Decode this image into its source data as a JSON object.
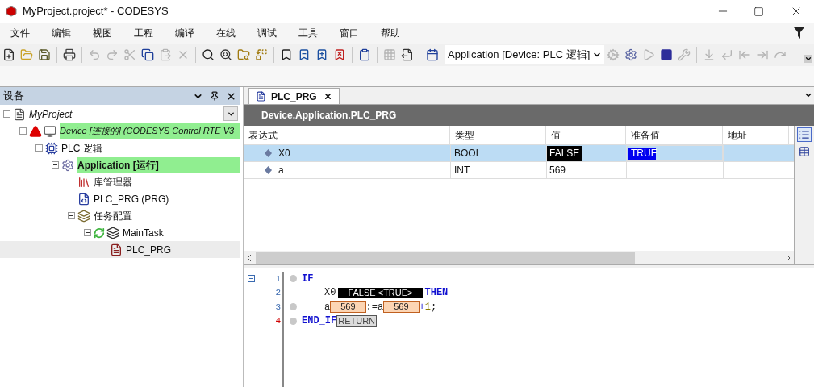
{
  "window": {
    "title": "MyProject.project* - CODESYS"
  },
  "menu": [
    "文件",
    "编辑",
    "视图",
    "工程",
    "编译",
    "在线",
    "调试",
    "工具",
    "窗口",
    "帮助"
  ],
  "toolbar": {
    "left": [
      {
        "kind": "new",
        "disabled": false
      },
      {
        "kind": "open",
        "disabled": false
      },
      {
        "kind": "save",
        "disabled": false
      },
      {
        "kind": "sep"
      },
      {
        "kind": "print",
        "disabled": false
      },
      {
        "kind": "sep"
      },
      {
        "kind": "undo",
        "disabled": true
      },
      {
        "kind": "redo",
        "disabled": true
      },
      {
        "kind": "cut",
        "disabled": true
      },
      {
        "kind": "copy",
        "disabled": false
      },
      {
        "kind": "paste",
        "disabled": true
      },
      {
        "kind": "delete",
        "disabled": true
      },
      {
        "kind": "sep"
      },
      {
        "kind": "find",
        "disabled": false
      },
      {
        "kind": "findnext",
        "disabled": false
      },
      {
        "kind": "findfolder",
        "disabled": false
      },
      {
        "kind": "replace",
        "disabled": false
      },
      {
        "kind": "sep"
      },
      {
        "kind": "bookmark",
        "disabled": false
      },
      {
        "kind": "bookmarkprev",
        "disabled": false
      },
      {
        "kind": "bookmarknext",
        "disabled": false
      },
      {
        "kind": "bookmarkclear",
        "disabled": false
      },
      {
        "kind": "sep"
      },
      {
        "kind": "objects",
        "disabled": false
      },
      {
        "kind": "sep"
      },
      {
        "kind": "grid",
        "disabled": true
      },
      {
        "kind": "export",
        "disabled": false
      },
      {
        "kind": "sep"
      },
      {
        "kind": "calendar",
        "disabled": false
      }
    ],
    "combo": {
      "value": "Application [Device: PLC 逻辑]"
    },
    "right": [
      {
        "kind": "login",
        "disabled": true
      },
      {
        "kind": "logout",
        "disabled": false
      },
      {
        "kind": "start",
        "disabled": true
      },
      {
        "kind": "stop",
        "disabled": false
      },
      {
        "kind": "reset",
        "disabled": true
      },
      {
        "kind": "sep"
      },
      {
        "kind": "stepover",
        "disabled": true
      },
      {
        "kind": "stepin",
        "disabled": true
      },
      {
        "kind": "stepout",
        "disabled": true
      },
      {
        "kind": "runto",
        "disabled": true
      },
      {
        "kind": "next",
        "disabled": true
      }
    ]
  },
  "devices_panel": {
    "title": "设备",
    "tree": [
      {
        "label": "MyProject",
        "kind": "project",
        "highlighted": false,
        "selected": false,
        "expanded": true,
        "children": [
          {
            "label": "Device [连接的] (CODESYS Control RTE V3",
            "kind": "device",
            "highlighted": true,
            "selected": false,
            "expanded": true,
            "children": [
              {
                "label": "PLC 逻辑",
                "kind": "plc",
                "highlighted": false,
                "selected": false,
                "expanded": true,
                "children": [
                  {
                    "label": "Application [运行]",
                    "kind": "application",
                    "highlighted": true,
                    "selected": false,
                    "expanded": true,
                    "children": [
                      {
                        "label": "库管理器",
                        "kind": "library",
                        "highlighted": false,
                        "selected": false
                      },
                      {
                        "label": "PLC_PRG (PRG)",
                        "kind": "pou",
                        "highlighted": false,
                        "selected": false
                      },
                      {
                        "label": "任务配置",
                        "kind": "taskconfig",
                        "highlighted": false,
                        "selected": false,
                        "expanded": true,
                        "children": [
                          {
                            "label": "MainTask",
                            "kind": "task",
                            "highlighted": false,
                            "selected": false,
                            "expanded": true,
                            "children": [
                              {
                                "label": "PLC_PRG",
                                "kind": "call",
                                "highlighted": false,
                                "selected": true
                              }
                            ]
                          }
                        ]
                      }
                    ]
                  }
                ]
              }
            ]
          }
        ]
      }
    ]
  },
  "editor": {
    "tabs": [
      {
        "label": "PLC_PRG",
        "selected": true
      }
    ],
    "path": "Device.Application.PLC_PRG",
    "watch": {
      "columns": [
        "表达式",
        "类型",
        "值",
        "准备值",
        "地址"
      ],
      "rows": [
        {
          "expression": "X0",
          "type": "BOOL",
          "value": "FALSE",
          "prepared": "TRUE",
          "kind": "bool",
          "selected": true
        },
        {
          "expression": "a",
          "type": "INT",
          "value": "569",
          "kind": "int",
          "selected": false
        }
      ]
    },
    "code": [
      {
        "number": "1",
        "foldable": true,
        "breakpoint": true,
        "current": false,
        "indent": false,
        "tokens": [
          {
            "kind": "keyword",
            "text": "IF"
          }
        ]
      },
      {
        "number": "2",
        "foldable": false,
        "breakpoint": false,
        "current": false,
        "indent": true,
        "tokens": [
          {
            "kind": "ident",
            "text": "X0"
          },
          {
            "kind": "boolmon",
            "text": "FALSE <TRUE>"
          },
          {
            "kind": "keyword",
            "text": "THEN"
          }
        ]
      },
      {
        "number": "3",
        "foldable": false,
        "breakpoint": true,
        "current": false,
        "indent": true,
        "tokens": [
          {
            "kind": "ident",
            "text": "a"
          },
          {
            "kind": "intmon",
            "text": "569"
          },
          {
            "kind": "ident",
            "text": ":=a"
          },
          {
            "kind": "intmon",
            "text": "569"
          },
          {
            "kind": "op",
            "text": "+"
          },
          {
            "kind": "num",
            "text": "1"
          },
          {
            "kind": "ident",
            "text": ";"
          }
        ]
      },
      {
        "number": "4",
        "foldable": false,
        "breakpoint": true,
        "current": true,
        "indent": false,
        "tokens": [
          {
            "kind": "keyword",
            "text": "END_IF"
          },
          {
            "kind": "return",
            "text": "RETURN"
          }
        ]
      }
    ]
  }
}
